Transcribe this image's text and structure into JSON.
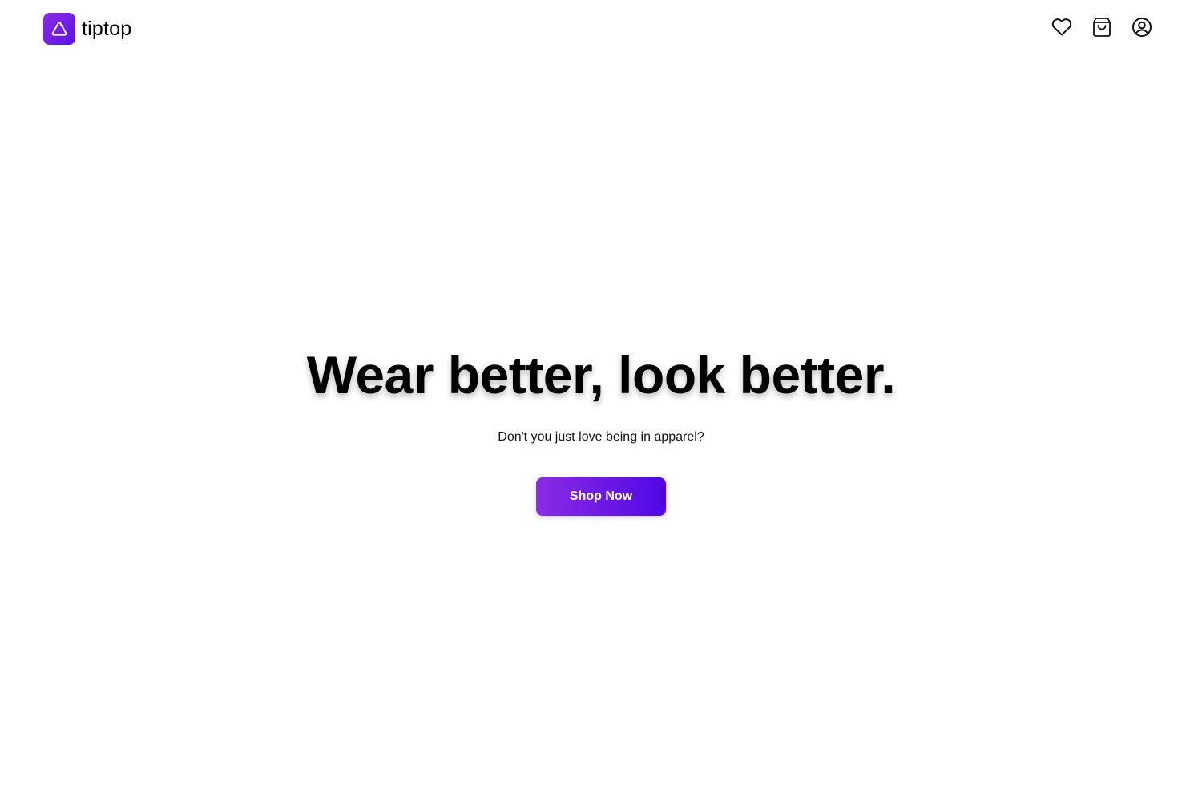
{
  "brand": {
    "name": "tiptop",
    "logo_icon": "triangle-logo-icon",
    "logo_gradient": [
      "#8b2ce6",
      "#5b10e8"
    ]
  },
  "header": {
    "icons": [
      {
        "name": "heart-icon",
        "label": "Wishlist"
      },
      {
        "name": "shopping-bag-icon",
        "label": "Cart"
      },
      {
        "name": "user-circle-icon",
        "label": "Account"
      }
    ]
  },
  "hero": {
    "title": "Wear better, look better.",
    "subtitle": "Don't you just love being in apparel?",
    "cta_label": "Shop Now",
    "cta_gradient": [
      "#8c2ce3",
      "#5007e6"
    ]
  }
}
